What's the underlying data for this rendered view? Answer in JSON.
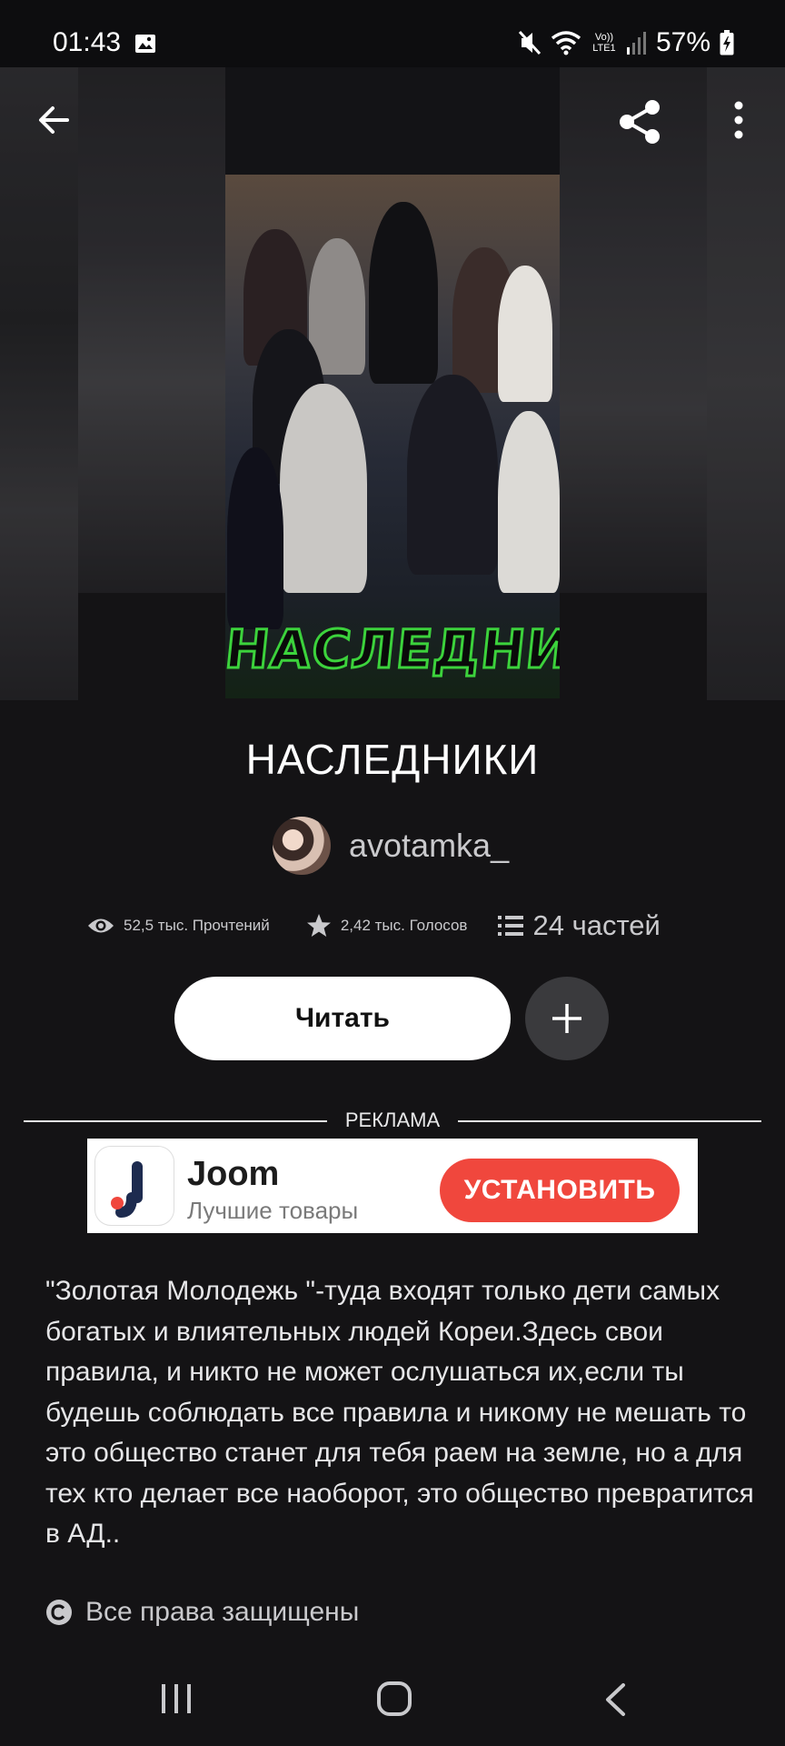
{
  "status_bar": {
    "time": "01:43",
    "network": "Vo)) LTE1",
    "battery": "57%"
  },
  "header": {
    "back_icon": "arrow-left-icon",
    "share_icon": "share-icon",
    "more_icon": "more-vertical-icon"
  },
  "cover": {
    "title_art": "НАСЛЕДНИКИ"
  },
  "story": {
    "title": "НАСЛЕДНИКИ",
    "author": "avotamka_"
  },
  "stats": {
    "reads": "52,5 тыс. Прочтений",
    "votes": "2,42 тыс. Голосов",
    "parts": "24 частей"
  },
  "actions": {
    "read_label": "Читать",
    "add_icon": "plus-icon"
  },
  "ad": {
    "label": "РЕКЛАМА",
    "brand": "Joom",
    "tagline": "Лучшие товары",
    "cta": "УСТАНОВИТЬ",
    "cta_color": "#f0473d"
  },
  "description": "\"Золотая Молодежь \"-туда входят только дети самых богатых и влиятельных людей Кореи.Здесь свои правила, и никто не может ослушаться их,если ты будешь соблюдать все правила и никому не мешать то это общество станет для тебя раем на земле, но а для тех кто делает все наоборот, это общество превратится в АД..",
  "copyright": "Все права защищены",
  "nav": {
    "recent_icon": "recent-apps-icon",
    "home_icon": "home-icon",
    "back_icon": "back-chevron-icon"
  }
}
